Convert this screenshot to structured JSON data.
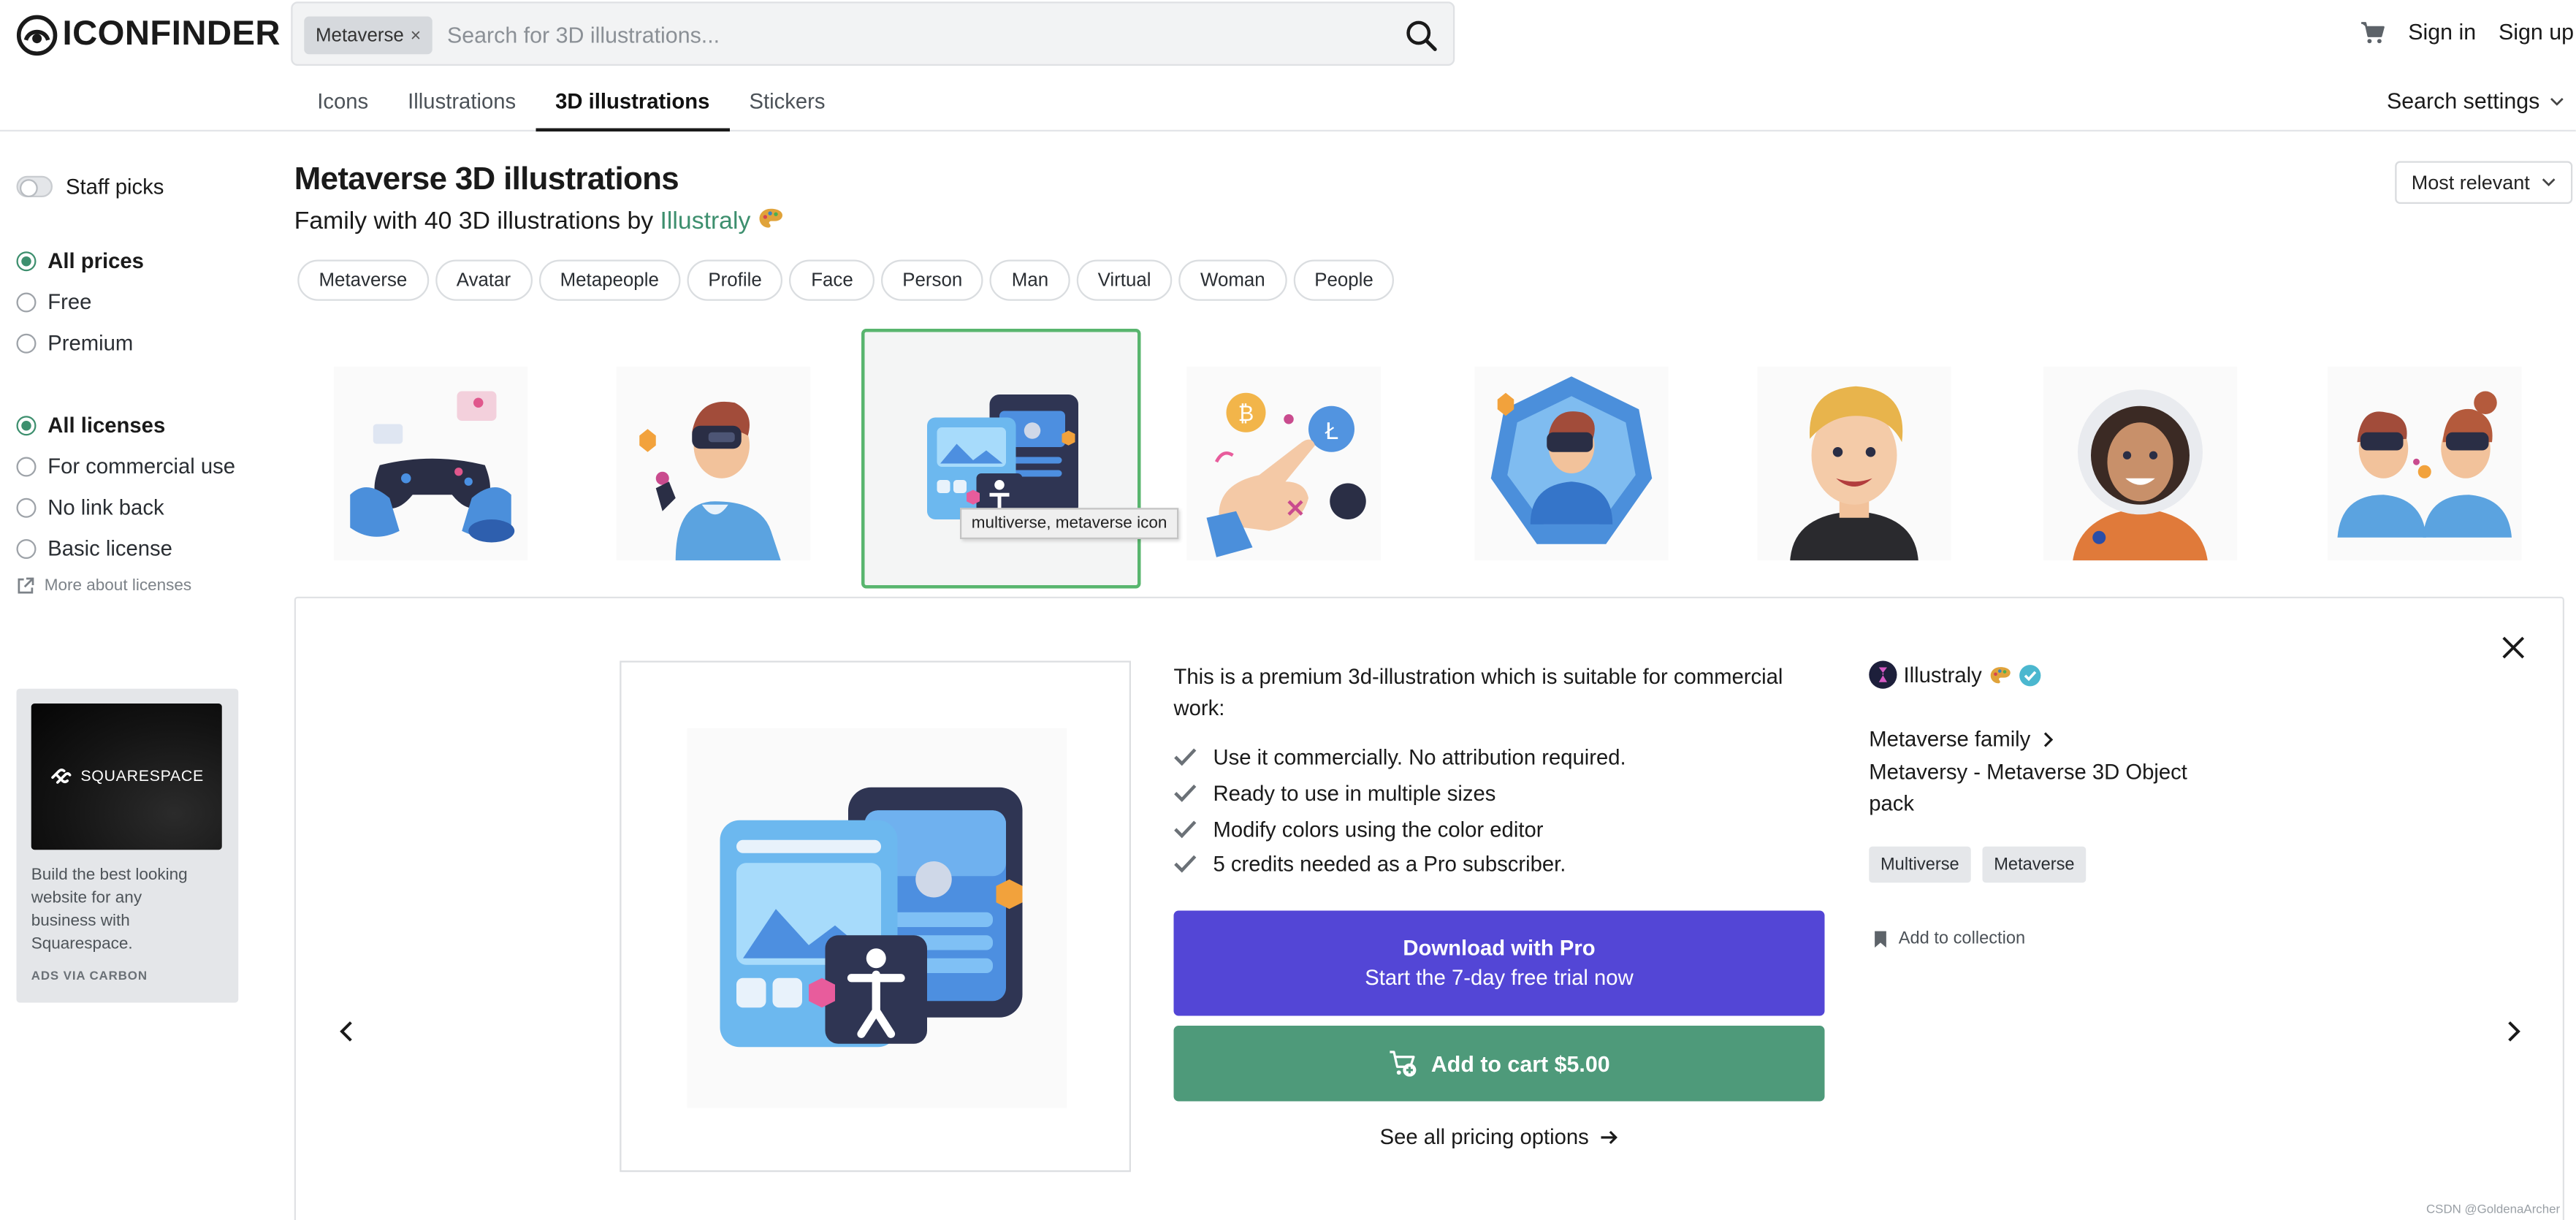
{
  "header": {
    "logo_text": "ICONFINDER",
    "search_chip": "Metaverse",
    "search_placeholder": "Search for 3D illustrations...",
    "sign_in": "Sign in",
    "sign_up": "Sign up",
    "tabs": [
      {
        "label": "Icons",
        "active": false
      },
      {
        "label": "Illustrations",
        "active": false
      },
      {
        "label": "3D illustrations",
        "active": true
      },
      {
        "label": "Stickers",
        "active": false
      }
    ],
    "search_settings": "Search settings"
  },
  "sidebar": {
    "staff_picks": "Staff picks",
    "prices": [
      {
        "label": "All prices",
        "selected": true
      },
      {
        "label": "Free",
        "selected": false
      },
      {
        "label": "Premium",
        "selected": false
      }
    ],
    "licenses": [
      {
        "label": "All licenses",
        "selected": true
      },
      {
        "label": "For commercial use",
        "selected": false
      },
      {
        "label": "No link back",
        "selected": false
      },
      {
        "label": "Basic license",
        "selected": false
      }
    ],
    "more_licenses": "More about licenses",
    "ad": {
      "brand": "SQUARESPACE",
      "text": "Build the best looking website for any business with Squarespace.",
      "via": "ADS VIA CARBON"
    }
  },
  "main": {
    "title": "Metaverse 3D illustrations",
    "subtitle_prefix": "Family with 40 3D illustrations by ",
    "author": "Illustraly",
    "sort_label": "Most relevant",
    "tags": [
      "Metaverse",
      "Avatar",
      "Metapeople",
      "Profile",
      "Face",
      "Person",
      "Man",
      "Virtual",
      "Woman",
      "People"
    ],
    "thumbnails": [
      "gamepad-hands",
      "vr-man",
      "multiverse-screens",
      "crypto-hand",
      "vr-portal",
      "blond-man",
      "astronaut-woman",
      "vr-couple"
    ],
    "tooltip": "multiverse, metaverse icon"
  },
  "detail": {
    "description": "This is a premium 3d-illustration which is suitable for commercial work:",
    "features": [
      "Use it commercially. No attribution required.",
      "Ready to use in multiple sizes",
      "Modify colors using the color editor",
      "5 credits needed as a Pro subscriber."
    ],
    "pro_line1": "Download with Pro",
    "pro_line2": "Start the 7-day free trial now",
    "cart_label": "Add to cart $5.00",
    "pricing_label": "See all pricing options",
    "author": "Illustraly",
    "family_link": "Metaverse family",
    "pack_name": "Metaversy - Metaverse 3D Object pack",
    "tags": [
      "Multiverse",
      "Metaverse"
    ],
    "add_collection": "Add to collection"
  },
  "watermark": "CSDN @GoldenaArcher",
  "colors": {
    "brand_green": "#3d8f6e",
    "pro_purple": "#5346d6",
    "cart_green": "#4e9a7a",
    "selection_green": "#58b56e"
  }
}
